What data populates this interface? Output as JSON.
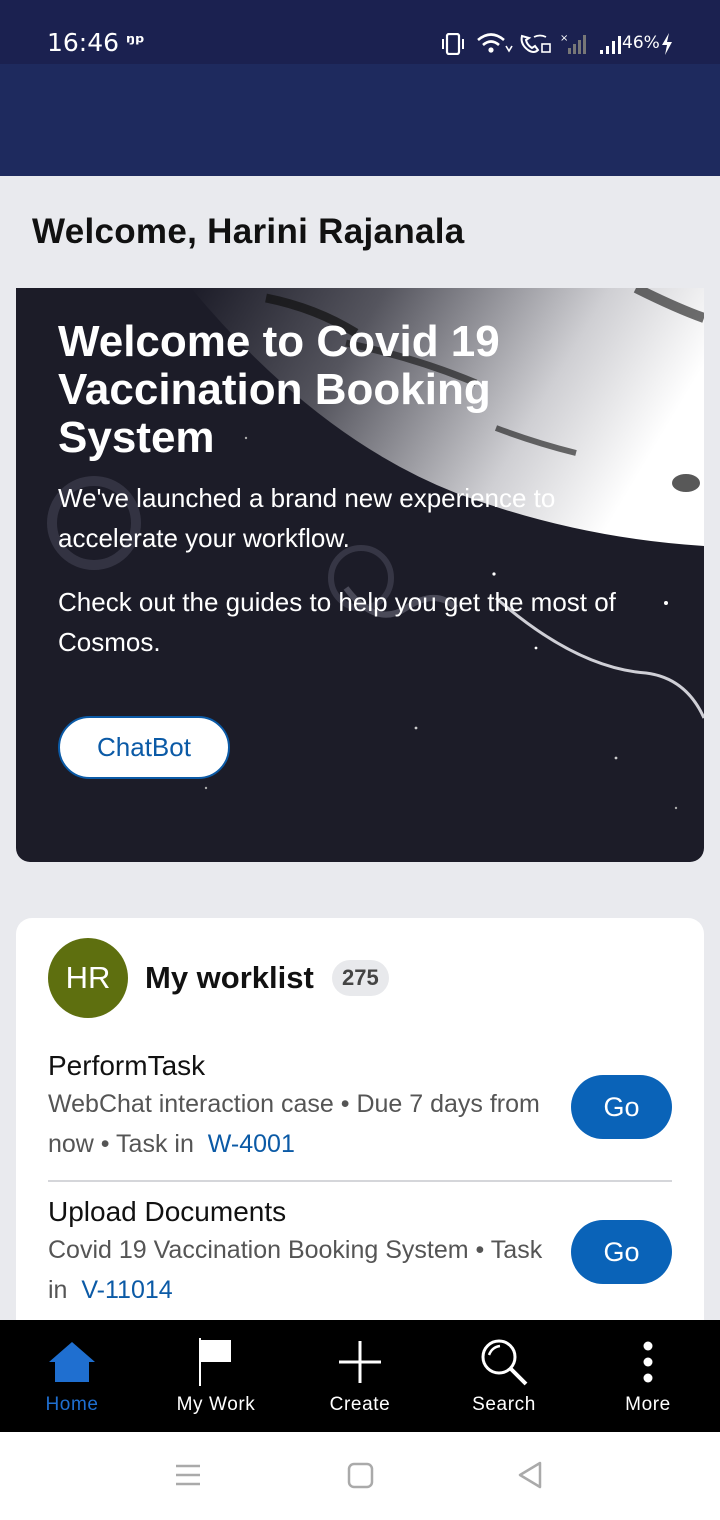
{
  "status_bar": {
    "time": "16:46",
    "app_indicator": "ᵑᵖ",
    "battery": "46%",
    "icons": [
      "vibrate-icon",
      "wifi-icon",
      "wifi-calling-icon",
      "signal-sim2-icon",
      "signal-icon",
      "charging-icon"
    ]
  },
  "welcome": {
    "greeting": "Welcome, Harini Rajanala"
  },
  "hero": {
    "heading": "Welcome to Covid 19 Vaccination Booking System",
    "paragraph_1": "We've launched a brand new experience to accelerate your workflow.",
    "paragraph_2": "Check out the guides to help you get the most of Cosmos.",
    "button_label": "ChatBot"
  },
  "worklist": {
    "avatar_initials": "HR",
    "avatar_color": "#5e6f0f",
    "title": "My worklist",
    "count": "275",
    "tasks": [
      {
        "title": "PerformTask",
        "meta": "WebChat interaction case  • Due 7 days from now  • Task in",
        "link": "W-4001",
        "action": "Go"
      },
      {
        "title": "Upload Documents",
        "meta": "Covid 19 Vaccination Booking System  • Task in",
        "link": "V-11014",
        "action": "Go"
      }
    ]
  },
  "bottom_nav": {
    "items": [
      {
        "label": "Home",
        "icon": "home-icon",
        "active": true
      },
      {
        "label": "My Work",
        "icon": "flag-icon",
        "active": false
      },
      {
        "label": "Create",
        "icon": "plus-icon",
        "active": false
      },
      {
        "label": "Search",
        "icon": "search-icon",
        "active": false
      },
      {
        "label": "More",
        "icon": "more-vertical-icon",
        "active": false
      }
    ]
  },
  "colors": {
    "status_bar": "#1b2150",
    "header": "#1e2a5e",
    "accent": "#0a63b8",
    "active_nav": "#1f6fd0"
  }
}
